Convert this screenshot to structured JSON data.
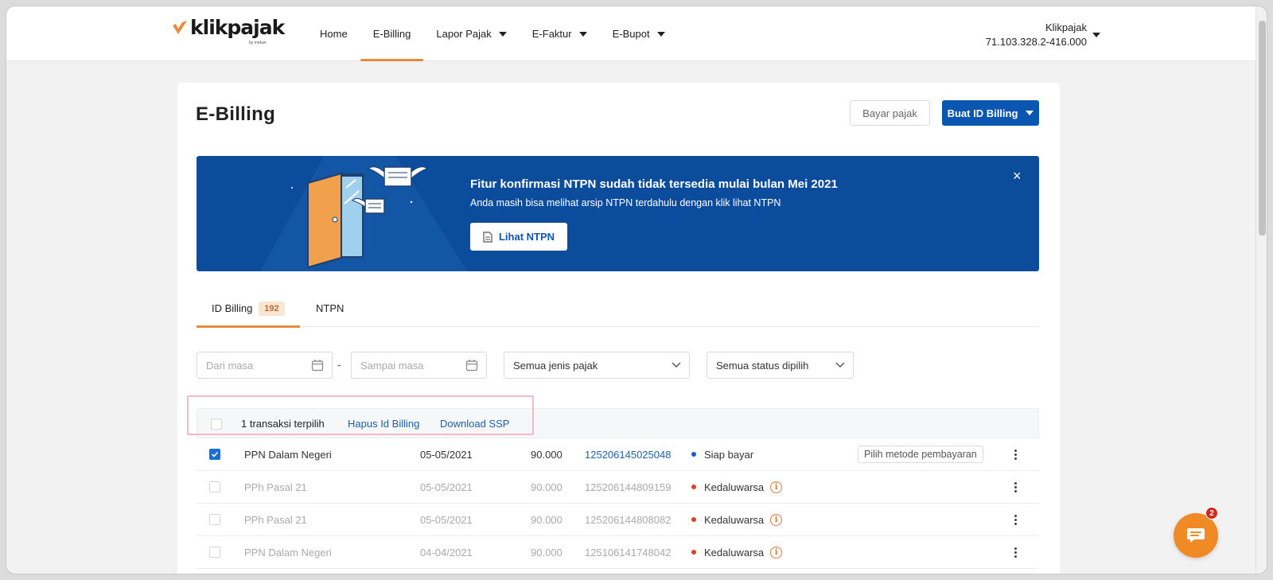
{
  "brand": {
    "name": "klikpajak",
    "tagline": "by mekari",
    "accent": "#e98a3f",
    "primary": "#0a56b0"
  },
  "nav": {
    "items": [
      {
        "label": "Home",
        "dropdown": false,
        "active": false
      },
      {
        "label": "E-Billing",
        "dropdown": false,
        "active": true
      },
      {
        "label": "Lapor Pajak",
        "dropdown": true,
        "active": false
      },
      {
        "label": "E-Faktur",
        "dropdown": true,
        "active": false
      },
      {
        "label": "E-Bupot",
        "dropdown": true,
        "active": false
      }
    ],
    "account": {
      "name": "Klikpajak",
      "npwp": "71.103.328.2-416.000"
    }
  },
  "page": {
    "title": "E-Billing",
    "bayar_label": "Bayar pajak",
    "buat_label": "Buat ID Billing"
  },
  "banner": {
    "title": "Fitur konfirmasi NTPN sudah tidak tersedia mulai bulan Mei 2021",
    "subtitle": "Anda masih bisa melihat arsip NTPN terdahulu dengan klik lihat NTPN",
    "button_label": "Lihat NTPN",
    "close": "×"
  },
  "tabs": [
    {
      "label": "ID Billing",
      "badge": "192",
      "active": true
    },
    {
      "label": "NTPN",
      "active": false
    }
  ],
  "filters": {
    "dari_placeholder": "Dari masa",
    "separator": "-",
    "sampai_placeholder": "Sampai masa",
    "jenis_value": "Semua jenis pajak",
    "status_value": "Semua status dipilih"
  },
  "selection": {
    "count_text": "1 transaksi terpilih",
    "hapus_label": "Hapus Id Billing",
    "download_label": "Download SSP"
  },
  "rows": [
    {
      "checked": true,
      "type": "PPN Dalam Negeri",
      "date": "05-05/2021",
      "amount": "90.000",
      "id": "125206145025048",
      "status": "Siap bayar",
      "status_color": "blue",
      "action": "Pilih metode pembayaran"
    },
    {
      "checked": false,
      "type": "PPh Pasal 21",
      "date": "05-05/2021",
      "amount": "90.000",
      "id": "125206144809159",
      "status": "Kedaluwarsa",
      "status_color": "red"
    },
    {
      "checked": false,
      "type": "PPh Pasal 21",
      "date": "05-05/2021",
      "amount": "90.000",
      "id": "125206144808082",
      "status": "Kedaluwarsa",
      "status_color": "red"
    },
    {
      "checked": false,
      "type": "PPN Dalam Negeri",
      "date": "04-04/2021",
      "amount": "90.000",
      "id": "125106141748042",
      "status": "Kedaluwarsa",
      "status_color": "red"
    }
  ],
  "chat": {
    "badge": "2"
  }
}
